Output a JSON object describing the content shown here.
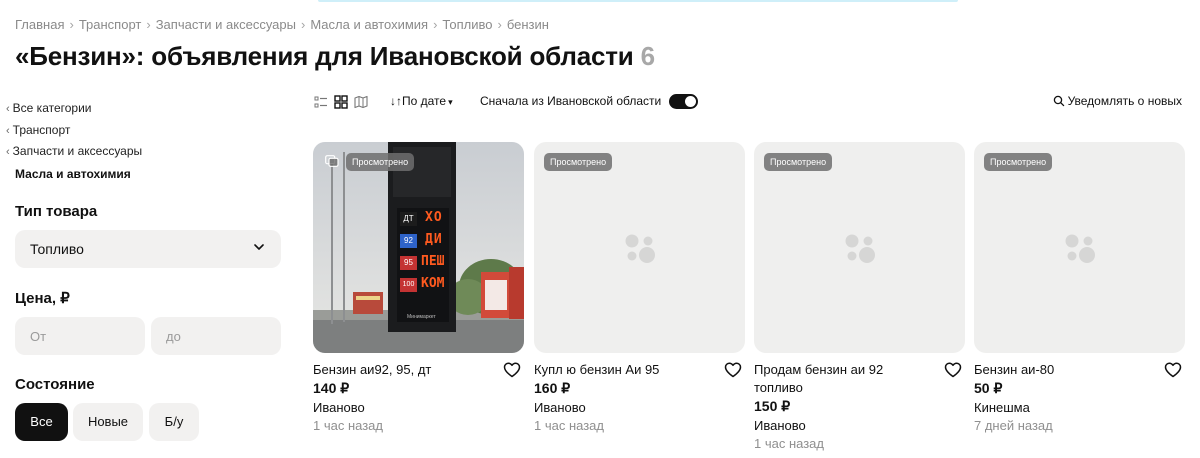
{
  "breadcrumb": [
    "Главная",
    "Транспорт",
    "Запчасти и аксессуары",
    "Масла и автохимия",
    "Топливо",
    "бензин"
  ],
  "page": {
    "title": "«Бензин»: объявления для Ивановской области",
    "count": "6"
  },
  "sidebar": {
    "categories": [
      "Все категории",
      "Транспорт",
      "Запчасти и аксессуары"
    ],
    "current_category": "Масла и автохимия",
    "type_filter": {
      "title": "Тип товара",
      "value": "Топливо"
    },
    "price_filter": {
      "title": "Цена, ₽",
      "from_placeholder": "От",
      "to_placeholder": "до"
    },
    "condition_filter": {
      "title": "Состояние",
      "options": [
        "Все",
        "Новые",
        "Б/у"
      ],
      "selected": "Все"
    }
  },
  "toolbar": {
    "view_icons": [
      "list-view-icon",
      "grid-view-icon",
      "map-view-icon"
    ],
    "sort_label": "По дате",
    "regional_label": "Сначала из Ивановской области",
    "regional_enabled": true,
    "notify_label": "Уведомлять о новых"
  },
  "listings": [
    {
      "badge": "Просмотрено",
      "title": "Бензин аи92, 95, дт",
      "price": "140 ₽",
      "city": "Иваново",
      "time": "1 час назад",
      "has_photo": true
    },
    {
      "badge": "Просмотрено",
      "title": "Купл ю бензин Аи 95",
      "price": "160 ₽",
      "city": "Иваново",
      "time": "1 час назад",
      "has_photo": false
    },
    {
      "badge": "Просмотрено",
      "title": "Продам бензин аи 92 топливо",
      "price": "150 ₽",
      "city": "Иваново",
      "time": "1 час назад",
      "has_photo": false
    },
    {
      "badge": "Просмотрено",
      "title": "Бензин аи-80",
      "price": "50 ₽",
      "city": "Кинешма",
      "time": "7 дней назад",
      "has_photo": false
    }
  ],
  "fuel_sign": {
    "rows": [
      {
        "grade": "ДТ",
        "word": "ХО",
        "grade_color": "#1c1c1c"
      },
      {
        "grade": "92",
        "word": "ДИ",
        "grade_color": "#2e63c9"
      },
      {
        "grade": "95",
        "word": "ПЕШ",
        "grade_color": "#c43333"
      },
      {
        "grade": "100",
        "word": "КОМ",
        "grade_color": "#c43333"
      }
    ],
    "footer": "Минимаркет"
  },
  "colors": {
    "accent": "#111111",
    "field_bg": "#f2f1f0",
    "muted_text": "#8f8f8f",
    "led": "#ff5a1f"
  }
}
